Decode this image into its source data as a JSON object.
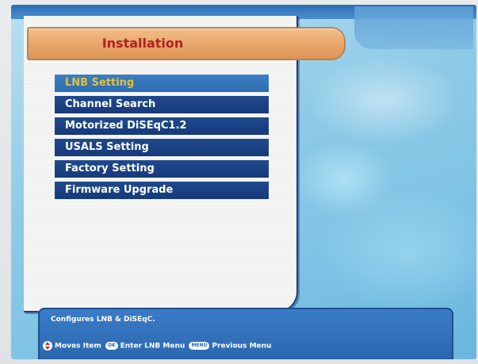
{
  "header": {
    "title": "Installation"
  },
  "menu": {
    "selected_index": 0,
    "items": [
      {
        "label": "LNB Setting"
      },
      {
        "label": "Channel Search"
      },
      {
        "label": "Motorized DiSEqC1.2"
      },
      {
        "label": "USALS Setting"
      },
      {
        "label": "Factory Setting"
      },
      {
        "label": "Firmware Upgrade"
      }
    ]
  },
  "help": {
    "description": "Configures LNB & DiSEqC.",
    "move_label": "Moves Item",
    "ok_key": "OK",
    "ok_label": "Enter LNB Menu",
    "menu_key": "MENU",
    "menu_label": "Previous Menu"
  },
  "colors": {
    "title_text": "#b02222",
    "title_bar": "#e8a46a",
    "menu_item_bg": "#16397a",
    "menu_item_selected_bg": "#2d6cb0",
    "menu_item_selected_text": "#e2c13a",
    "help_bar_bg": "#2b68b1"
  }
}
